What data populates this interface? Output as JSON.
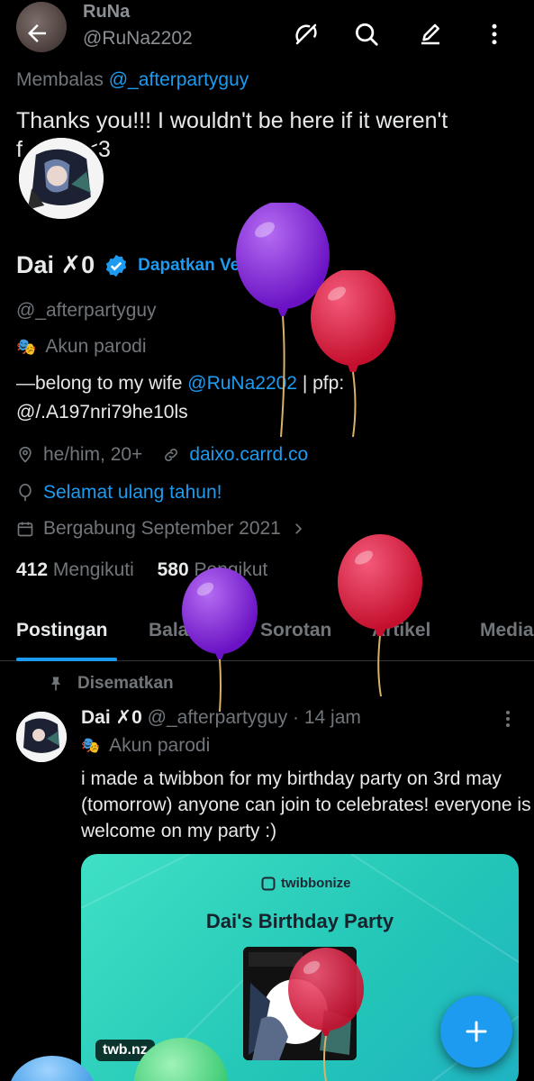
{
  "header": {
    "name": "RuNa",
    "handle": "@RuNa2202"
  },
  "reply": {
    "prefix": "Membalas",
    "mention": "@_afterpartyguy"
  },
  "tweet": {
    "text": "Thanks you!!! I wouldn't be here if it weren't f<span></span>"
  },
  "tweet_text_line1": "Thanks you!!! I wouldn't be here if it weren't",
  "tweet_text_line2": "f          <3",
  "profile": {
    "name": "Dai ✗0",
    "verify_cta": "Dapatkan Verifikasi",
    "handle": "@_afterpartyguy",
    "parody_label": "Akun parodi",
    "bio_line1_prefix": "—belong to my wife ",
    "bio_mention": "@RuNa2202",
    "bio_line1_suffix": " | pfp:",
    "bio_line2": "@/.A197nri79he10ls",
    "pronouns": "he/him, 20+",
    "website": "daixo.carrd.co",
    "birthday": "Selamat ulang tahun!",
    "joined": "Bergabung September 2021",
    "following_count": "412",
    "following_label": "Mengikuti",
    "followers_count": "580",
    "followers_label": "Pengikut"
  },
  "tabs": [
    "Postingan",
    "Balasan",
    "Sorotan",
    "Artikel",
    "Media"
  ],
  "post": {
    "pinned_label": "Disematkan",
    "name": "Dai ✗0",
    "handle_time": "@_afterpartyguy · 14 jam",
    "parody_label": "Akun parodi",
    "text": "i made a twibbon for my birthday party on 3rd may (tomorrow) anyone can join to celebrates! everyone is welcome on my party :)",
    "card": {
      "brand": "twibbonize",
      "title": "Dai's Birthday Party",
      "domain": "twb.nz"
    }
  },
  "colors": {
    "accent": "#1d9bf0",
    "background": "#000000",
    "balloon_purple": "#8a2be2",
    "balloon_red": "#e0244a"
  }
}
